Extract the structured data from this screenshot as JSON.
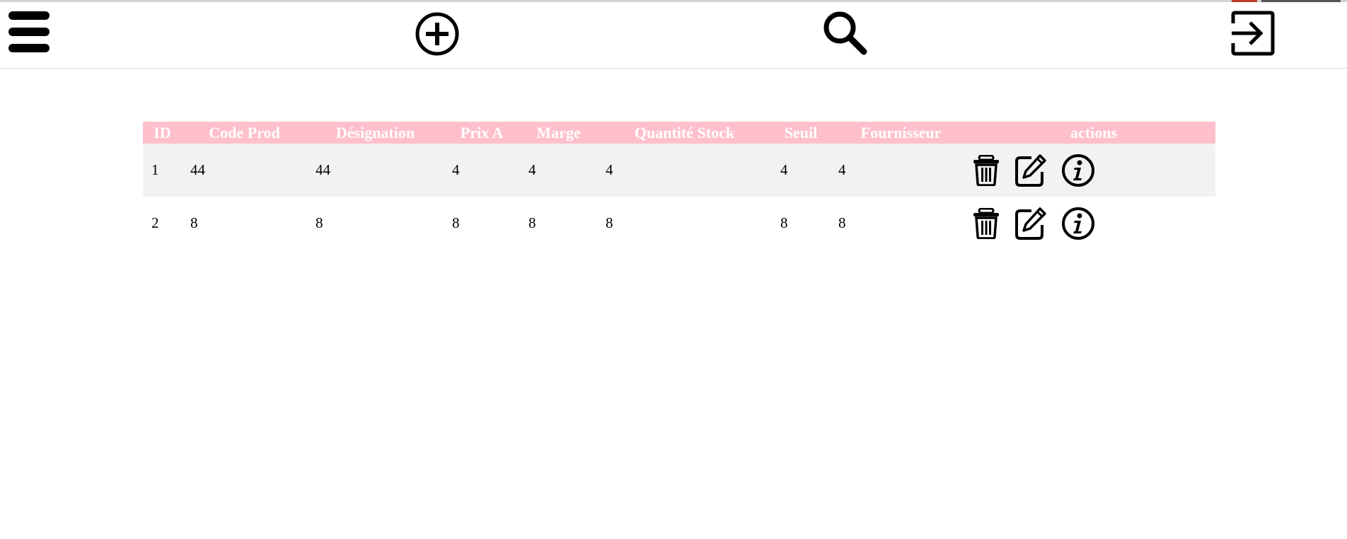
{
  "toolbar": {
    "menu_icon": "hamburger-menu-icon",
    "add_icon": "circle-plus-icon",
    "search_icon": "magnifier-icon",
    "logout_icon": "sign-in-arrow-icon"
  },
  "table": {
    "headers": {
      "id": "ID",
      "code": "Code Prod",
      "designation": "Désignation",
      "prix": "Prix A",
      "marge": "Marge",
      "quantite": "Quantité Stock",
      "seuil": "Seuil",
      "fournisseur": "Fournisseur",
      "actions": "actions"
    },
    "rows": [
      {
        "id": "1",
        "code": "44",
        "designation": "44",
        "prix": "4",
        "marge": "4",
        "quantite": "4",
        "seuil": "4",
        "fournisseur": "4"
      },
      {
        "id": "2",
        "code": "8",
        "designation": "8",
        "prix": "8",
        "marge": "8",
        "quantite": "8",
        "seuil": "8",
        "fournisseur": "8"
      }
    ],
    "header_color": "#ffc0cb",
    "stripe_color": "#f2f2f2",
    "action_icons": [
      "trash-icon",
      "edit-icon",
      "info-icon"
    ]
  }
}
